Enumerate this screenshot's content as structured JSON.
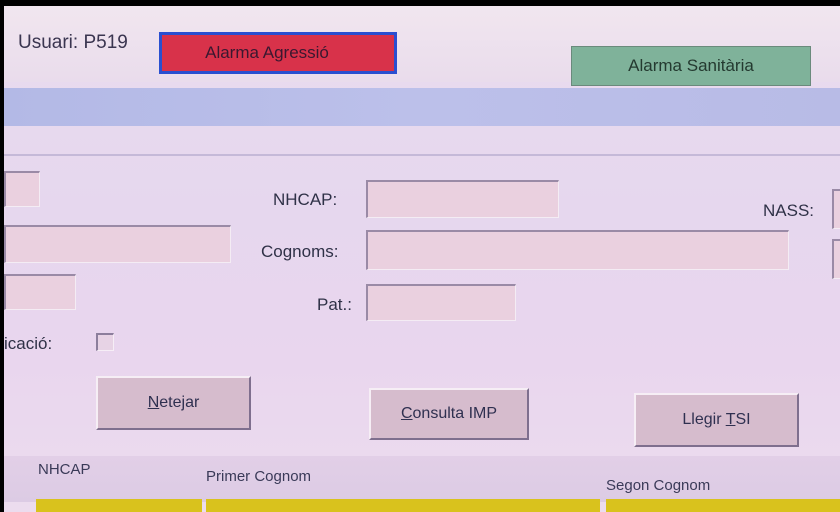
{
  "header": {
    "user_label": "Usuari: P519",
    "alarm_aggression": "Alarma Agressió",
    "alarm_health": "Alarma Sanitària"
  },
  "form": {
    "nhcap_label": "NHCAP:",
    "nass_label": "NASS:",
    "cognoms_label": "Cognoms:",
    "pat_label": "Pat.:",
    "verification_label": "icació:",
    "nhcap_value": "",
    "cognoms_value": "",
    "pat_value": "",
    "nass_value": ""
  },
  "buttons": {
    "clear_prefix": "N",
    "clear_rest": "etejar",
    "consult_prefix": "C",
    "consult_rest": "onsulta IMP",
    "read_tsi_pre": "Llegir ",
    "read_tsi_u": "T",
    "read_tsi_post": "SI"
  },
  "table": {
    "columns": [
      "NHCAP",
      "Primer Cognom",
      "Segon Cognom"
    ]
  },
  "colors": {
    "alarm_aggression_bg": "#d8324a",
    "alarm_health_bg": "#7fb29a",
    "row_highlight": "#d9c21d"
  }
}
